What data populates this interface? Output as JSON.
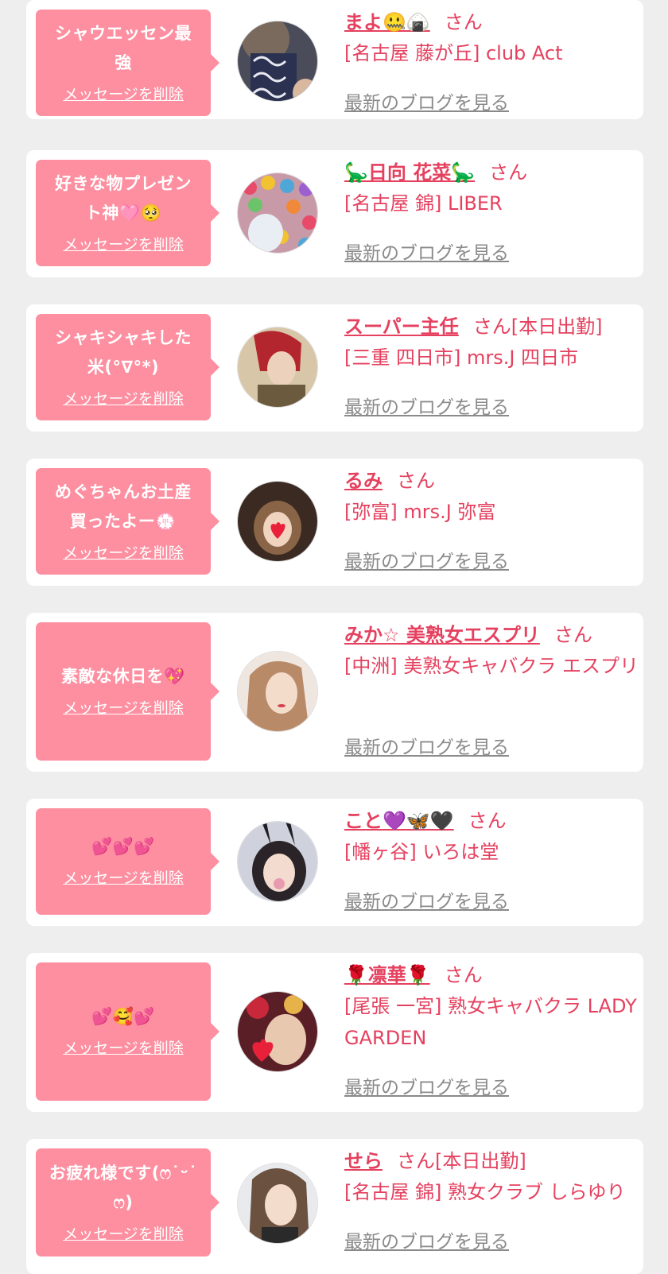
{
  "delete_label": "メッセージを削除",
  "blog_label": "最新のブログを見る",
  "honorific": "さん",
  "colors": {
    "background": "#eeeeee",
    "card": "#ffffff",
    "bubble": "#fd8fa0",
    "accent": "#e5415f",
    "blog_link": "#8a8a8a"
  },
  "messages": [
    {
      "message": "シャウエッセン最\n強",
      "name": "まよ🤐🍙",
      "status": "",
      "shop": "[名古屋 藤が丘] club Act",
      "avatar": "avatar-photo"
    },
    {
      "message": "好きな物プレゼン\nト神🩷🥺",
      "name": "🦕日向 花菜🦕",
      "status": "",
      "shop": "[名古屋 錦] LIBER",
      "avatar": "avatar-photo"
    },
    {
      "message": "シャキシャキした\n米(°∇°*)",
      "name": "スーパー主任",
      "status": "[本日出勤]",
      "shop": "[三重 四日市] mrs.J 四日市",
      "avatar": "avatar-photo"
    },
    {
      "message": "めぐちゃんお土産\n買ったよー💮",
      "name": "るみ",
      "status": "",
      "shop": "[弥富] mrs.J 弥富",
      "avatar": "avatar-photo"
    },
    {
      "message": "素敵な休日を💖",
      "name": "みか☆ 美熟女エスプリ",
      "status": "",
      "shop": "[中洲] 美熟女キャバクラ エスプリ",
      "avatar": "avatar-photo"
    },
    {
      "message": "💕💕💕",
      "name": "こと💜🦋🖤",
      "status": "",
      "shop": "[幡ヶ谷] いろは堂",
      "avatar": "avatar-photo"
    },
    {
      "message": "💕🥰💕",
      "name": "🌹凛華🌹",
      "status": "",
      "shop": "[尾張 一宮] 熟女キャバクラ LADY GARDEN",
      "avatar": "avatar-photo"
    },
    {
      "message": "お疲れ様です(ෆ˙ᵕ˙\nෆ)",
      "name": "せら",
      "status": "[本日出勤]",
      "shop": "[名古屋 錦] 熟女クラブ しらゆり",
      "avatar": "avatar-photo"
    }
  ]
}
